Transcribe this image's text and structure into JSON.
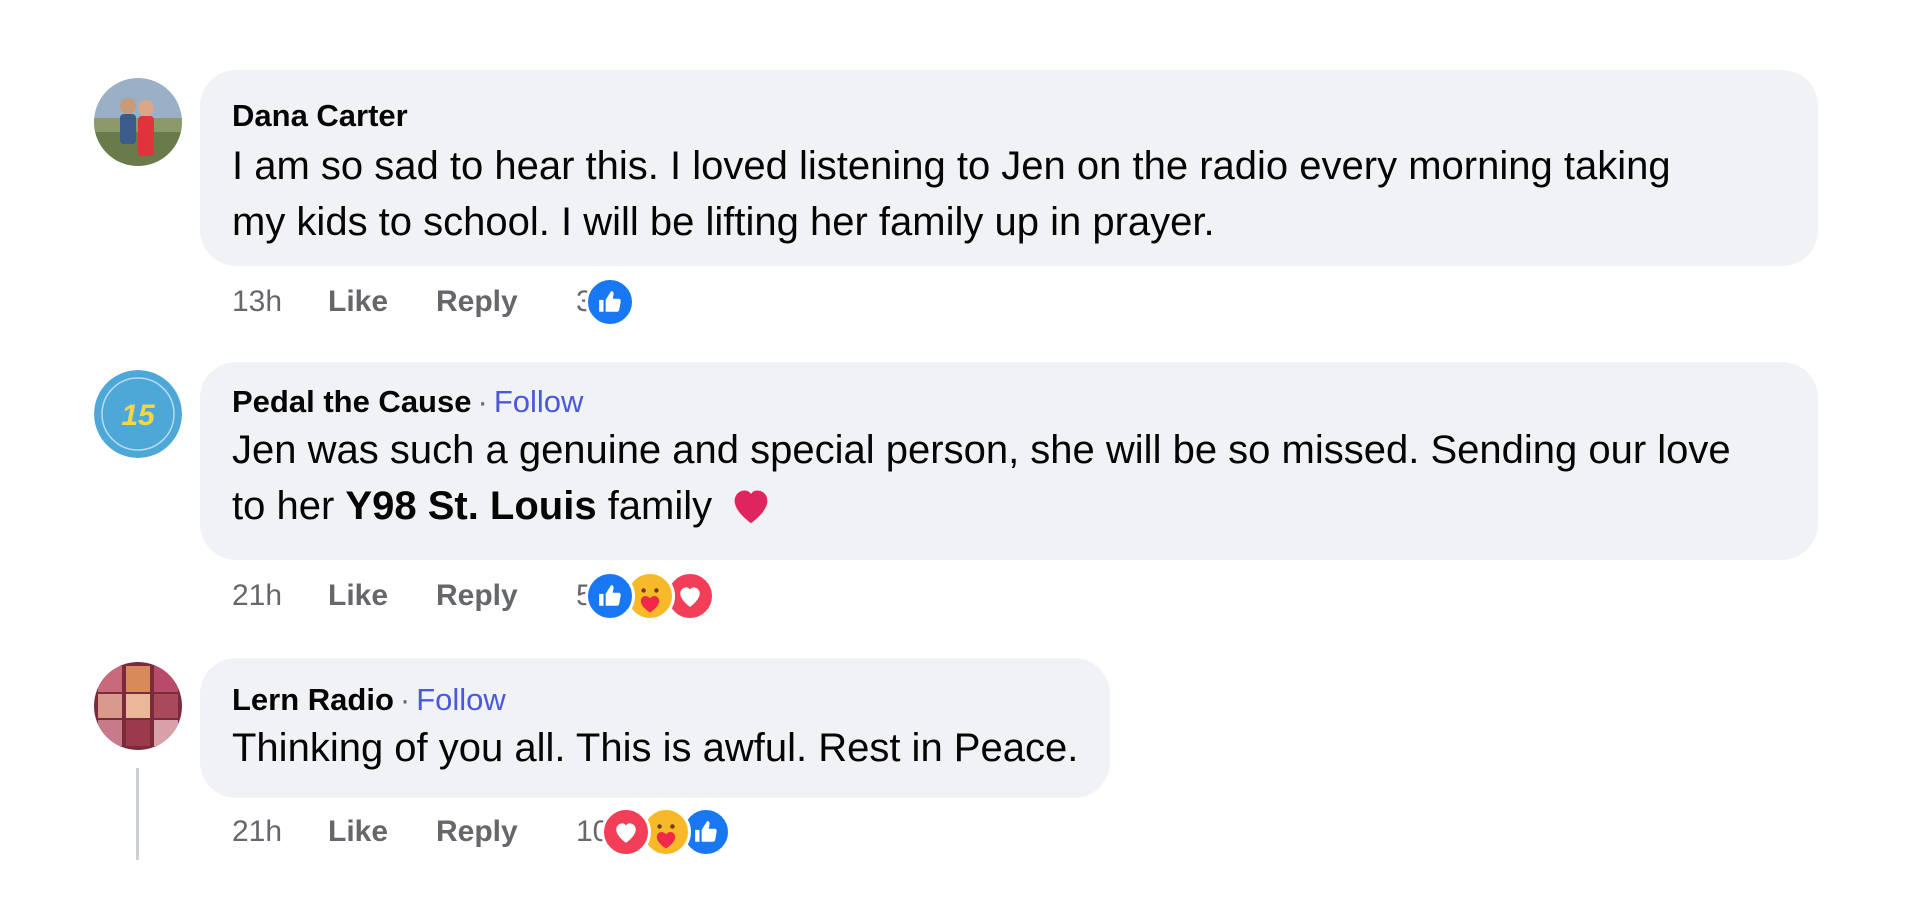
{
  "comments": [
    {
      "author": "Dana Carter",
      "follow": "",
      "line1": "I am so sad to hear this. I loved listening to Jen on the radio every morning taking",
      "line2": "my kids to school. I will be lifting her family up in prayer.",
      "time": "13h",
      "like": "Like",
      "reply": "Reply",
      "reaction_count": "3",
      "reactions": [
        "like-icon"
      ]
    },
    {
      "author": "Pedal the Cause",
      "follow": "Follow",
      "line1": "Jen was such a genuine and special person, she will be so missed. Sending our love",
      "line2_pre": "to her ",
      "line2_bold": "Y98 St. Louis",
      "line2_post": " family",
      "emoji": "heart-emoji",
      "time": "21h",
      "like": "Like",
      "reply": "Reply",
      "reaction_count": "5",
      "reactions": [
        "like-icon",
        "care-icon",
        "love-icon"
      ]
    },
    {
      "author": "Lern Radio",
      "follow": "Follow",
      "line1": "Thinking of you all. This is awful. Rest in Peace.",
      "time": "21h",
      "like": "Like",
      "reply": "Reply",
      "reaction_count": "10",
      "reactions": [
        "love-icon",
        "care-icon",
        "like-icon"
      ]
    }
  ],
  "avatars": {
    "pedal_badge": "15"
  },
  "colors": {
    "bubble": "#f0f2f5",
    "follow": "#4a59d9",
    "like_reaction": "#1877f2",
    "love_reaction": "#f33e58",
    "care_reaction": "#f7b928",
    "meta_text": "#65676b"
  }
}
